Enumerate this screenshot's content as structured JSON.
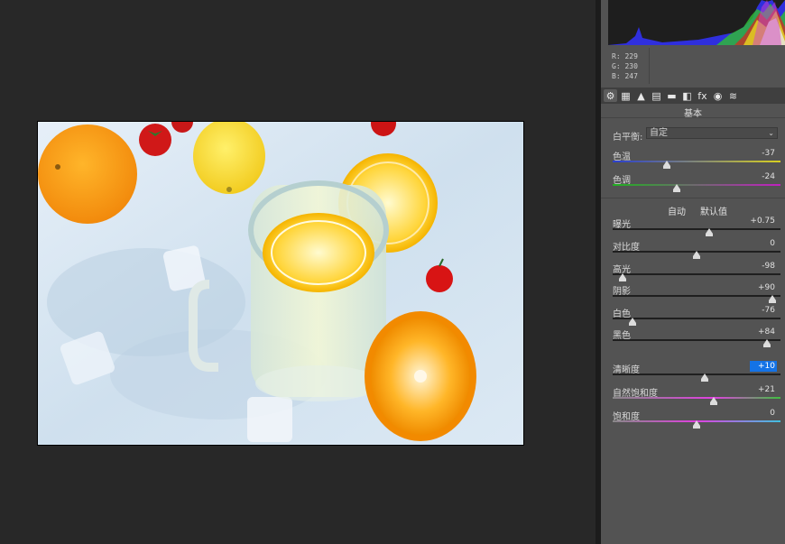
{
  "histogram_readout": {
    "r": "R:  229",
    "g": "G:  230",
    "b": "B:  247"
  },
  "panel": {
    "tabs": [
      {
        "name": "basic-tab-icon",
        "glyph": "⚙"
      },
      {
        "name": "tone-curve-tab-icon",
        "glyph": "▦"
      },
      {
        "name": "detail-tab-icon",
        "glyph": "▲"
      },
      {
        "name": "hsl-tab-icon",
        "glyph": "▤"
      },
      {
        "name": "split-toning-tab-icon",
        "glyph": "▬"
      },
      {
        "name": "lens-corrections-tab-icon",
        "glyph": "◧"
      },
      {
        "name": "effects-tab-icon",
        "glyph": "fx"
      },
      {
        "name": "camera-calibration-tab-icon",
        "glyph": "◉"
      },
      {
        "name": "presets-tab-icon",
        "glyph": "≋"
      }
    ],
    "section_title": "基本",
    "white_balance": {
      "label": "白平衡:",
      "value": "自定"
    },
    "auto_label": "自动",
    "default_label": "默认值",
    "sliders": {
      "temperature": {
        "label": "色温",
        "value": "-37",
        "level": 0.32
      },
      "tint": {
        "label": "色调",
        "value": "-24",
        "level": 0.38
      },
      "exposure": {
        "label": "曝光",
        "value": "+0.75",
        "level": 0.575
      },
      "contrast": {
        "label": "对比度",
        "value": "0",
        "level": 0.5
      },
      "highlights": {
        "label": "高光",
        "value": "-98",
        "level": 0.06
      },
      "shadows": {
        "label": "阴影",
        "value": "+90",
        "level": 0.95
      },
      "whites": {
        "label": "白色",
        "value": "-76",
        "level": 0.12
      },
      "blacks": {
        "label": "黑色",
        "value": "+84",
        "level": 0.92
      },
      "clarity": {
        "label": "清晰度",
        "value": "+10",
        "level": 0.55
      },
      "vibrance": {
        "label": "自然饱和度",
        "value": "+21",
        "level": 0.6
      },
      "saturation": {
        "label": "饱和度",
        "value": "0",
        "level": 0.5
      }
    }
  },
  "colors": {
    "panel_bg": "#535353",
    "canvas_bg": "#282828",
    "accent": "#1473e6"
  }
}
